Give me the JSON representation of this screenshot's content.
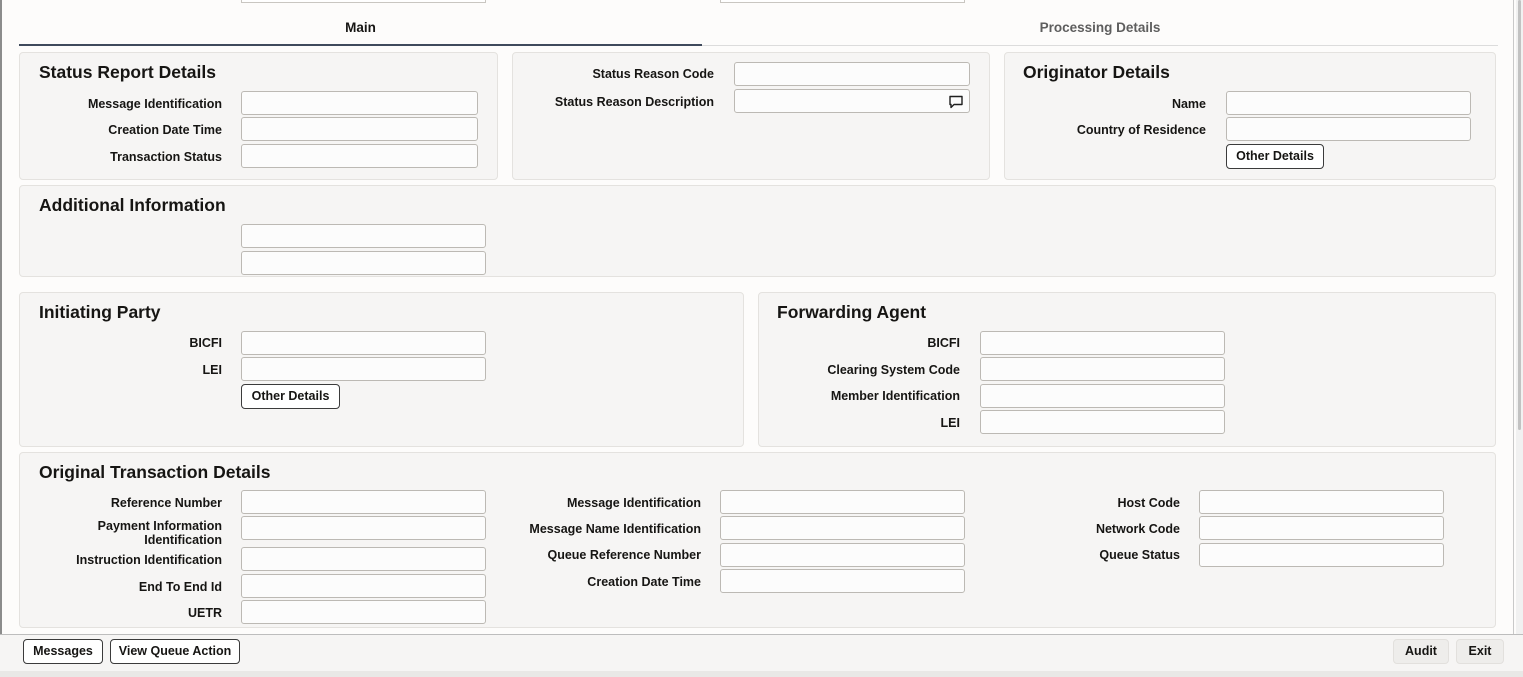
{
  "tabs": {
    "main": "Main",
    "processing": "Processing Details"
  },
  "status_report": {
    "title": "Status Report Details",
    "message_identification_label": "Message Identification",
    "message_identification_value": "",
    "creation_date_time_label": "Creation Date Time",
    "creation_date_time_value": "",
    "transaction_status_label": "Transaction Status",
    "transaction_status_value": ""
  },
  "status_reason": {
    "code_label": "Status Reason Code",
    "code_value": "",
    "description_label": "Status Reason Description",
    "description_value": ""
  },
  "originator": {
    "title": "Originator Details",
    "name_label": "Name",
    "name_value": "",
    "country_label": "Country of Residence",
    "country_value": "",
    "other_details_button": "Other Details"
  },
  "additional_info": {
    "title": "Additional Information",
    "line1": "",
    "line2": ""
  },
  "initiating_party": {
    "title": "Initiating Party",
    "bicfi_label": "BICFI",
    "bicfi_value": "",
    "lei_label": "LEI",
    "lei_value": "",
    "other_details_button": "Other Details"
  },
  "forwarding_agent": {
    "title": "Forwarding Agent",
    "bicfi_label": "BICFI",
    "bicfi_value": "",
    "clearing_label": "Clearing System Code",
    "clearing_value": "",
    "member_label": "Member Identification",
    "member_value": "",
    "lei_label": "LEI",
    "lei_value": ""
  },
  "original_transaction": {
    "title": "Original Transaction Details",
    "reference_number_label": "Reference Number",
    "reference_number_value": "",
    "payment_info_label": "Payment Information Identification",
    "payment_info_value": "",
    "instruction_id_label": "Instruction Identification",
    "instruction_id_value": "",
    "end_to_end_label": "End To End Id",
    "end_to_end_value": "",
    "uetr_label": "UETR",
    "uetr_value": "",
    "message_id_label": "Message Identification",
    "message_id_value": "",
    "message_name_label": "Message Name Identification",
    "message_name_value": "",
    "queue_ref_label": "Queue Reference Number",
    "queue_ref_value": "",
    "creation_date_time_label": "Creation Date Time",
    "creation_date_time_value": "",
    "host_code_label": "Host Code",
    "host_code_value": "",
    "network_code_label": "Network Code",
    "network_code_value": "",
    "queue_status_label": "Queue Status",
    "queue_status_value": ""
  },
  "footer": {
    "messages_button": "Messages",
    "view_queue_action_button": "View Queue Action",
    "audit_button": "Audit",
    "exit_button": "Exit"
  },
  "icons": {
    "description_expand": "speech-bubble-icon"
  },
  "colors": {
    "active_tab_underline": "#3f4a5c",
    "panel_background": "#f6f5f4",
    "text": "#161513"
  }
}
